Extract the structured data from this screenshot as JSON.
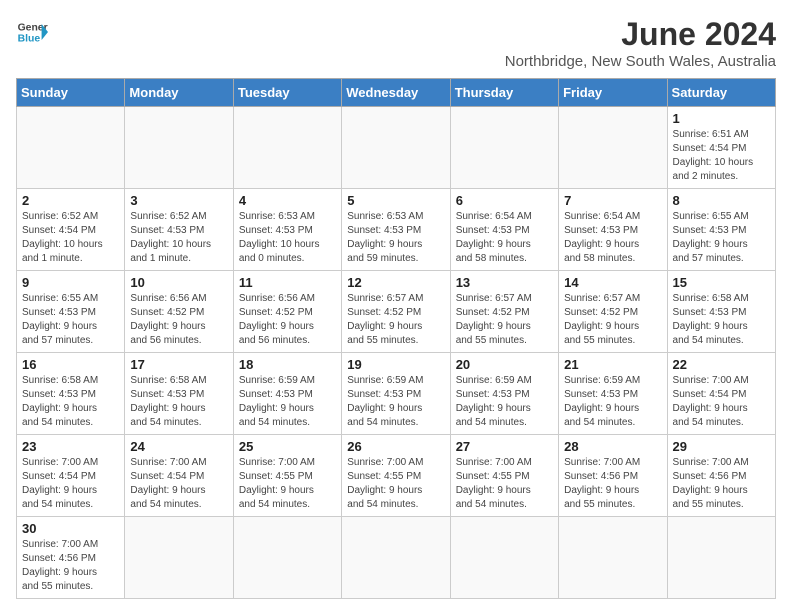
{
  "header": {
    "logo_line1": "General",
    "logo_line2": "Blue",
    "title": "June 2024",
    "subtitle": "Northbridge, New South Wales, Australia"
  },
  "weekdays": [
    "Sunday",
    "Monday",
    "Tuesday",
    "Wednesday",
    "Thursday",
    "Friday",
    "Saturday"
  ],
  "weeks": [
    [
      {
        "day": "",
        "info": ""
      },
      {
        "day": "",
        "info": ""
      },
      {
        "day": "",
        "info": ""
      },
      {
        "day": "",
        "info": ""
      },
      {
        "day": "",
        "info": ""
      },
      {
        "day": "",
        "info": ""
      },
      {
        "day": "1",
        "info": "Sunrise: 6:51 AM\nSunset: 4:54 PM\nDaylight: 10 hours\nand 2 minutes."
      }
    ],
    [
      {
        "day": "2",
        "info": "Sunrise: 6:52 AM\nSunset: 4:54 PM\nDaylight: 10 hours\nand 1 minute."
      },
      {
        "day": "3",
        "info": "Sunrise: 6:52 AM\nSunset: 4:53 PM\nDaylight: 10 hours\nand 1 minute."
      },
      {
        "day": "4",
        "info": "Sunrise: 6:53 AM\nSunset: 4:53 PM\nDaylight: 10 hours\nand 0 minutes."
      },
      {
        "day": "5",
        "info": "Sunrise: 6:53 AM\nSunset: 4:53 PM\nDaylight: 9 hours\nand 59 minutes."
      },
      {
        "day": "6",
        "info": "Sunrise: 6:54 AM\nSunset: 4:53 PM\nDaylight: 9 hours\nand 58 minutes."
      },
      {
        "day": "7",
        "info": "Sunrise: 6:54 AM\nSunset: 4:53 PM\nDaylight: 9 hours\nand 58 minutes."
      },
      {
        "day": "8",
        "info": "Sunrise: 6:55 AM\nSunset: 4:53 PM\nDaylight: 9 hours\nand 57 minutes."
      }
    ],
    [
      {
        "day": "9",
        "info": "Sunrise: 6:55 AM\nSunset: 4:53 PM\nDaylight: 9 hours\nand 57 minutes."
      },
      {
        "day": "10",
        "info": "Sunrise: 6:56 AM\nSunset: 4:52 PM\nDaylight: 9 hours\nand 56 minutes."
      },
      {
        "day": "11",
        "info": "Sunrise: 6:56 AM\nSunset: 4:52 PM\nDaylight: 9 hours\nand 56 minutes."
      },
      {
        "day": "12",
        "info": "Sunrise: 6:57 AM\nSunset: 4:52 PM\nDaylight: 9 hours\nand 55 minutes."
      },
      {
        "day": "13",
        "info": "Sunrise: 6:57 AM\nSunset: 4:52 PM\nDaylight: 9 hours\nand 55 minutes."
      },
      {
        "day": "14",
        "info": "Sunrise: 6:57 AM\nSunset: 4:52 PM\nDaylight: 9 hours\nand 55 minutes."
      },
      {
        "day": "15",
        "info": "Sunrise: 6:58 AM\nSunset: 4:53 PM\nDaylight: 9 hours\nand 54 minutes."
      }
    ],
    [
      {
        "day": "16",
        "info": "Sunrise: 6:58 AM\nSunset: 4:53 PM\nDaylight: 9 hours\nand 54 minutes."
      },
      {
        "day": "17",
        "info": "Sunrise: 6:58 AM\nSunset: 4:53 PM\nDaylight: 9 hours\nand 54 minutes."
      },
      {
        "day": "18",
        "info": "Sunrise: 6:59 AM\nSunset: 4:53 PM\nDaylight: 9 hours\nand 54 minutes."
      },
      {
        "day": "19",
        "info": "Sunrise: 6:59 AM\nSunset: 4:53 PM\nDaylight: 9 hours\nand 54 minutes."
      },
      {
        "day": "20",
        "info": "Sunrise: 6:59 AM\nSunset: 4:53 PM\nDaylight: 9 hours\nand 54 minutes."
      },
      {
        "day": "21",
        "info": "Sunrise: 6:59 AM\nSunset: 4:53 PM\nDaylight: 9 hours\nand 54 minutes."
      },
      {
        "day": "22",
        "info": "Sunrise: 7:00 AM\nSunset: 4:54 PM\nDaylight: 9 hours\nand 54 minutes."
      }
    ],
    [
      {
        "day": "23",
        "info": "Sunrise: 7:00 AM\nSunset: 4:54 PM\nDaylight: 9 hours\nand 54 minutes."
      },
      {
        "day": "24",
        "info": "Sunrise: 7:00 AM\nSunset: 4:54 PM\nDaylight: 9 hours\nand 54 minutes."
      },
      {
        "day": "25",
        "info": "Sunrise: 7:00 AM\nSunset: 4:55 PM\nDaylight: 9 hours\nand 54 minutes."
      },
      {
        "day": "26",
        "info": "Sunrise: 7:00 AM\nSunset: 4:55 PM\nDaylight: 9 hours\nand 54 minutes."
      },
      {
        "day": "27",
        "info": "Sunrise: 7:00 AM\nSunset: 4:55 PM\nDaylight: 9 hours\nand 54 minutes."
      },
      {
        "day": "28",
        "info": "Sunrise: 7:00 AM\nSunset: 4:56 PM\nDaylight: 9 hours\nand 55 minutes."
      },
      {
        "day": "29",
        "info": "Sunrise: 7:00 AM\nSunset: 4:56 PM\nDaylight: 9 hours\nand 55 minutes."
      }
    ],
    [
      {
        "day": "30",
        "info": "Sunrise: 7:00 AM\nSunset: 4:56 PM\nDaylight: 9 hours\nand 55 minutes."
      },
      {
        "day": "",
        "info": ""
      },
      {
        "day": "",
        "info": ""
      },
      {
        "day": "",
        "info": ""
      },
      {
        "day": "",
        "info": ""
      },
      {
        "day": "",
        "info": ""
      },
      {
        "day": "",
        "info": ""
      }
    ]
  ]
}
